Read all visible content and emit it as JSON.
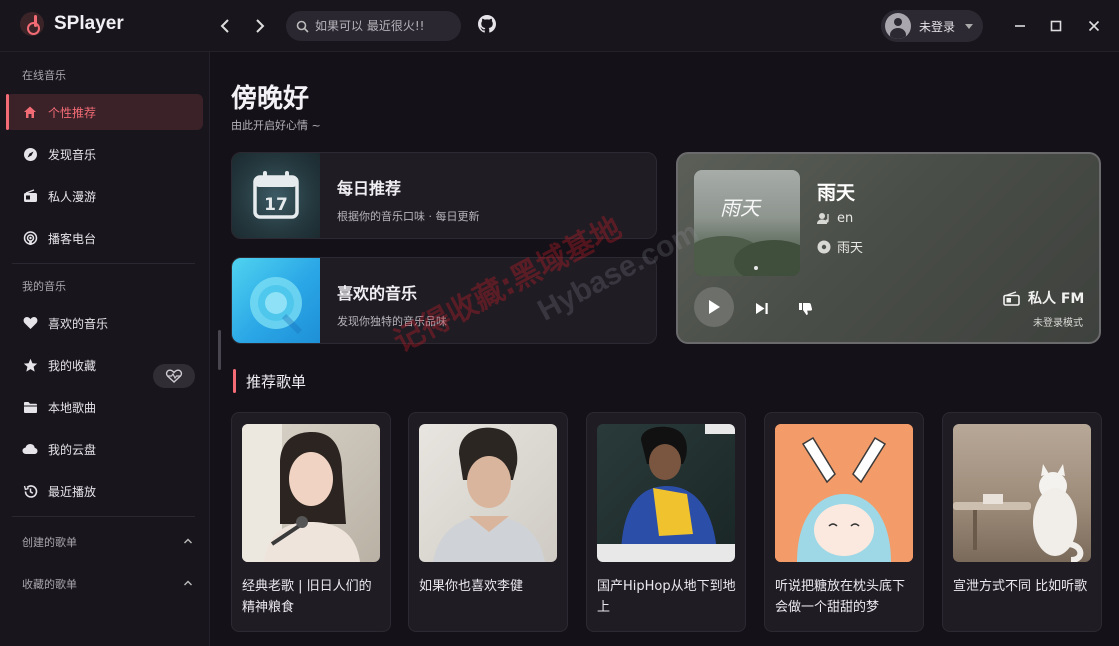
{
  "app": {
    "name": "SPlayer"
  },
  "search": {
    "placeholder": "如果可以 最近很火!!"
  },
  "user": {
    "label": "未登录"
  },
  "sidebar": {
    "sections": {
      "online": "在线音乐",
      "mine": "我的音乐",
      "created": "创建的歌单",
      "collected": "收藏的歌单"
    },
    "online_items": [
      {
        "label": "个性推荐",
        "icon": "home-icon"
      },
      {
        "label": "发现音乐",
        "icon": "compass-icon"
      },
      {
        "label": "私人漫游",
        "icon": "radio-icon"
      },
      {
        "label": "播客电台",
        "icon": "podcast-icon"
      }
    ],
    "mine_items": [
      {
        "label": "喜欢的音乐",
        "icon": "heart-icon"
      },
      {
        "label": "我的收藏",
        "icon": "star-icon"
      },
      {
        "label": "本地歌曲",
        "icon": "folder-icon"
      },
      {
        "label": "我的云盘",
        "icon": "cloud-icon"
      },
      {
        "label": "最近播放",
        "icon": "history-icon"
      }
    ]
  },
  "main": {
    "greeting": "傍晚好",
    "subtitle": "由此开启好心情 ~",
    "cards": [
      {
        "title": "每日推荐",
        "desc": "根据你的音乐口味 · 每日更新",
        "date": "17"
      },
      {
        "title": "喜欢的音乐",
        "desc": "发现你独特的音乐品味"
      }
    ],
    "fm": {
      "song": "雨天",
      "artist": "en",
      "album": "雨天",
      "cover_text": "雨天",
      "label": "私人 FM",
      "mode": "未登录模式"
    },
    "section_title": "推荐歌单",
    "playlists": [
      {
        "title": "经典老歌 | 旧日人们的精神粮食"
      },
      {
        "title": "如果你也喜欢李健"
      },
      {
        "title": "国产HipHop从地下到地上"
      },
      {
        "title": "听说把糖放在枕头底下会做一个甜甜的梦"
      },
      {
        "title": "宣泄方式不同 比如听歌"
      }
    ]
  },
  "watermark": {
    "cn": "记得收藏:黑域基地",
    "en": "Hybase.com"
  },
  "colors": {
    "accent": "#f26b75",
    "background": "#141118",
    "panel": "#18151c"
  }
}
